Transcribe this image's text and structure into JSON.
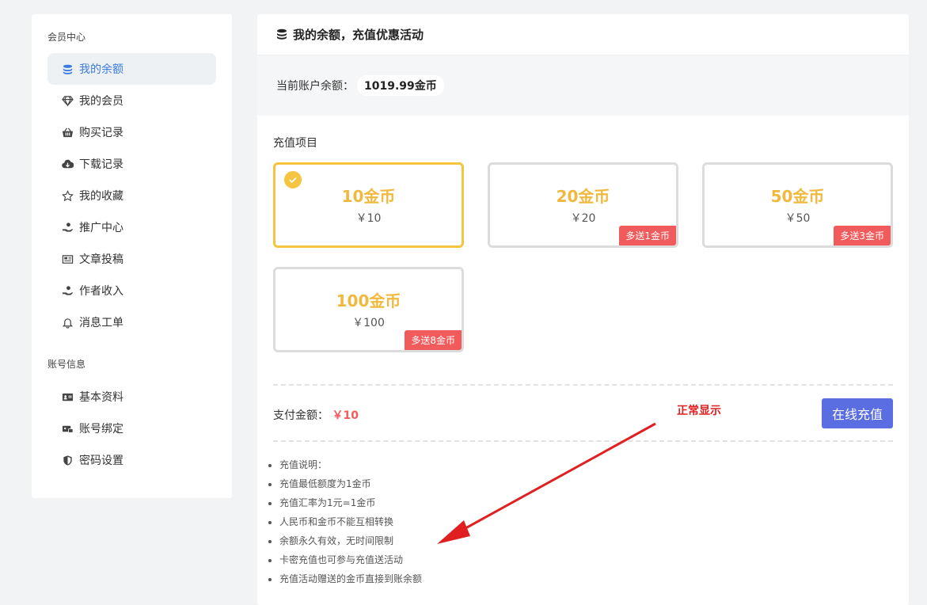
{
  "sidebar": {
    "group1_title": "会员中心",
    "items": [
      {
        "label": "我的余额",
        "icon": "coins-icon"
      },
      {
        "label": "我的会员",
        "icon": "diamond-icon"
      },
      {
        "label": "购买记录",
        "icon": "basket-icon"
      },
      {
        "label": "下载记录",
        "icon": "cloud-download-icon"
      },
      {
        "label": "我的收藏",
        "icon": "star-icon"
      },
      {
        "label": "推广中心",
        "icon": "hand-coin-icon"
      },
      {
        "label": "文章投稿",
        "icon": "newspaper-icon"
      },
      {
        "label": "作者收入",
        "icon": "hand-coin-icon"
      },
      {
        "label": "消息工单",
        "icon": "bell-icon"
      }
    ],
    "group2_title": "账号信息",
    "items2": [
      {
        "label": "基本资料",
        "icon": "id-card-icon"
      },
      {
        "label": "账号绑定",
        "icon": "link-account-icon"
      },
      {
        "label": "密码设置",
        "icon": "shield-icon"
      }
    ]
  },
  "main": {
    "title": "我的余额，充值优惠活动",
    "balance_label": "当前账户余额：",
    "balance_value": "1019.99金币",
    "section_label": "充值项目",
    "options": [
      {
        "amount": "10金币",
        "price": "￥10",
        "bonus": ""
      },
      {
        "amount": "20金币",
        "price": "￥20",
        "bonus": "多送1金币"
      },
      {
        "amount": "50金币",
        "price": "￥50",
        "bonus": "多送3金币"
      },
      {
        "amount": "100金币",
        "price": "￥100",
        "bonus": "多送8金币"
      }
    ],
    "selected_option": 0,
    "pay_label": "支付金额：",
    "pay_amount": "￥10",
    "recharge_button": "在线充值",
    "notes": [
      "充值说明：",
      "充值最低额度为1金币",
      "充值汇率为1元=1金币",
      "人民币和金币不能互相转换",
      "余额永久有效，无时间限制",
      "卡密充值也可参与充值送活动",
      "充值活动赠送的金币直接到账余额"
    ]
  },
  "annotation": {
    "text": "正常显示"
  },
  "colors": {
    "accent": "#3a7be0",
    "gold": "#f0b93e",
    "selected_border": "#f5c542",
    "bonus": "#f25b5b",
    "button": "#5b6ee1",
    "annotation": "#e02020"
  }
}
